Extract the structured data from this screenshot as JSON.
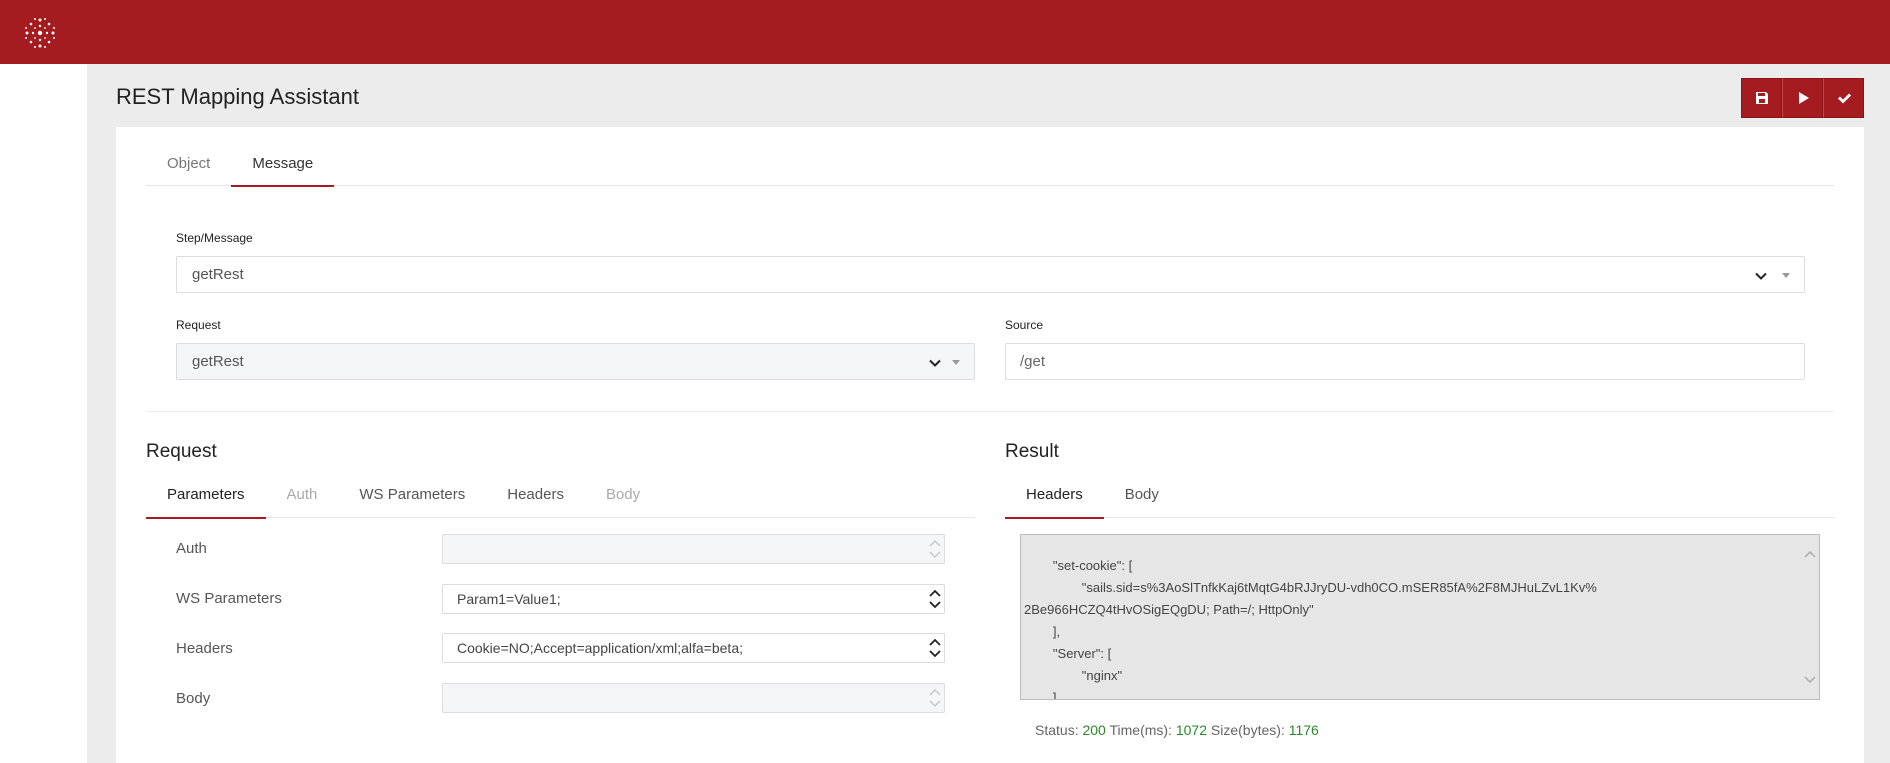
{
  "header": {
    "logo_icon": "snowflake-dots-logo",
    "bg_color": "#a51c20"
  },
  "page": {
    "title": "REST Mapping Assistant"
  },
  "toolbar": {
    "buttons": [
      {
        "icon": "save-icon"
      },
      {
        "icon": "play-icon"
      },
      {
        "icon": "check-icon"
      }
    ]
  },
  "top_tabs": [
    {
      "label": "Object",
      "active": false
    },
    {
      "label": "Message",
      "active": true
    }
  ],
  "form": {
    "step_message": {
      "label": "Step/Message",
      "value": "getRest"
    },
    "request": {
      "label": "Request",
      "value": "getRest"
    },
    "source": {
      "label": "Source",
      "value": "/get"
    }
  },
  "request_section": {
    "title": "Request",
    "tabs": [
      {
        "label": "Parameters",
        "state": "active"
      },
      {
        "label": "Auth",
        "state": "disabled"
      },
      {
        "label": "WS Parameters",
        "state": "normal"
      },
      {
        "label": "Headers",
        "state": "normal"
      },
      {
        "label": "Body",
        "state": "disabled"
      }
    ],
    "rows": [
      {
        "label": "Auth",
        "value": ""
      },
      {
        "label": "WS Parameters",
        "value": "Param1=Value1;"
      },
      {
        "label": "Headers",
        "value": "Cookie=NO;Accept=application/xml;alfa=beta;"
      },
      {
        "label": "Body",
        "value": ""
      }
    ]
  },
  "result_section": {
    "title": "Result",
    "tabs": [
      {
        "label": "Headers",
        "state": "active"
      },
      {
        "label": "Body",
        "state": "normal"
      }
    ],
    "content": "        \"set-cookie\": [\n                \"sails.sid=s%3AoSlTnfkKaj6tMqtG4bRJJryDU-vdh0CO.mSER85fA%2F8MJHuLZvL1Kv%\n2Be966HCZQ4tHvOSigEQgDU; Path=/; HttpOnly\"\n        ],\n        \"Server\": [\n                \"nginx\"\n        ],",
    "status": {
      "status_label": "Status:",
      "status_value": "200",
      "time_label": "Time(ms):",
      "time_value": "1072",
      "size_label": "Size(bytes):",
      "size_value": "1176"
    }
  }
}
